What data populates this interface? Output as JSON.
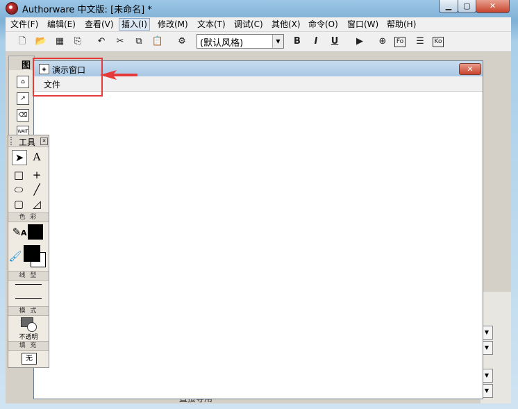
{
  "window": {
    "title": "Authorware 中文版: [未命名] *",
    "minimize": "▁",
    "maximize": "▢",
    "close": "✕"
  },
  "menubar": {
    "items": [
      "文件(F)",
      "编辑(E)",
      "查看(V)",
      "插入(I)",
      "修改(M)",
      "文本(T)",
      "调试(C)",
      "其他(X)",
      "命令(O)",
      "窗口(W)",
      "帮助(H)"
    ],
    "selected_index": 3
  },
  "toolbar": {
    "style_select_value": "(默认风格)",
    "bold_label": "B",
    "italic_label": "I",
    "underline_label": "U",
    "fxo_label": "Fo",
    "ko_label": "Ko"
  },
  "icon_palette": {
    "title": "图"
  },
  "presentation_window": {
    "title": "演示窗口",
    "menu_file": "文件",
    "close": "✕"
  },
  "annotation": {
    "highlight_color": "#e63a3a"
  },
  "tools_panel": {
    "title": "工具",
    "color_label": "色 彩",
    "line_label": "线 型",
    "mode_label": "模 式",
    "mode_value": "不透明",
    "fill_label": "填 充",
    "fill_value": "无"
  },
  "background_text": "直接导用"
}
